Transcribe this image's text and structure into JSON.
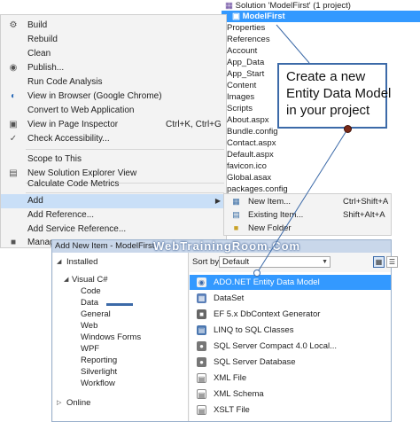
{
  "solution_explorer": {
    "solution": "Solution 'ModelFirst' (1 project)",
    "project": "ModelFirst",
    "items": [
      "Properties",
      "References",
      "Account",
      "App_Data",
      "App_Start",
      "Content",
      "Images",
      "Scripts",
      "About.aspx",
      "Bundle.config",
      "Contact.aspx",
      "Default.aspx",
      "favicon.ico",
      "Global.asax",
      "packages.config"
    ]
  },
  "context_menu": {
    "items": [
      {
        "label": "Build",
        "shortcut": "",
        "icon": "build-icon"
      },
      {
        "label": "Rebuild",
        "shortcut": "",
        "icon": ""
      },
      {
        "label": "Clean",
        "shortcut": "",
        "icon": ""
      },
      {
        "label": "Publish...",
        "shortcut": "",
        "icon": "publish-icon"
      },
      {
        "label": "Run Code Analysis",
        "shortcut": "",
        "icon": ""
      },
      {
        "label": "View in Browser (Google Chrome)",
        "shortcut": "",
        "icon": "browser-icon"
      },
      {
        "label": "Convert to Web Application",
        "shortcut": "",
        "icon": ""
      },
      {
        "label": "View in Page Inspector",
        "shortcut": "Ctrl+K, Ctrl+G",
        "icon": "inspector-icon"
      },
      {
        "label": "Check Accessibility...",
        "shortcut": "",
        "icon": "accessibility-icon"
      },
      {
        "label": "Scope to This",
        "shortcut": "",
        "icon": ""
      },
      {
        "label": "New Solution Explorer View",
        "shortcut": "",
        "icon": "explorer-view-icon"
      },
      {
        "label": "Calculate Code Metrics",
        "shortcut": "",
        "icon": ""
      },
      {
        "label": "Add",
        "shortcut": "",
        "icon": ""
      },
      {
        "label": "Add Reference...",
        "shortcut": "",
        "icon": ""
      },
      {
        "label": "Add Service Reference...",
        "shortcut": "",
        "icon": ""
      },
      {
        "label": "Manage",
        "shortcut": "",
        "icon": "manage-icon"
      }
    ]
  },
  "submenu": {
    "items": [
      {
        "label": "New Item...",
        "shortcut": "Ctrl+Shift+A"
      },
      {
        "label": "Existing Item...",
        "shortcut": "Shift+Alt+A"
      },
      {
        "label": "New Folder",
        "shortcut": ""
      }
    ]
  },
  "callout": {
    "lines": [
      "Create a new",
      "Entity Data Model",
      "in your project"
    ]
  },
  "dialog": {
    "title": "Add New Item - ModelFirst",
    "watermark": "WebTrainingRoom.Com",
    "tree": {
      "installed": "Installed",
      "visual_csharp": "Visual C#",
      "children": [
        "Code",
        "Data",
        "General",
        "Web",
        "Windows Forms",
        "WPF",
        "Reporting",
        "Silverlight",
        "Workflow"
      ],
      "online": "Online"
    },
    "sort_label": "Sort by:",
    "sort_value": "Default",
    "templates": [
      "ADO.NET Entity Data Model",
      "DataSet",
      "EF 5.x DbContext Generator",
      "LINQ to SQL Classes",
      "SQL Server Compact 4.0 Local...",
      "SQL Server Database",
      "XML File",
      "XML Schema",
      "XSLT File"
    ]
  },
  "colors": {
    "selection": "#3399ff",
    "menu_bg": "#f3f3f3",
    "callout_border": "#3c6aa8",
    "dialog_title_bg": "#c9d7ea"
  }
}
